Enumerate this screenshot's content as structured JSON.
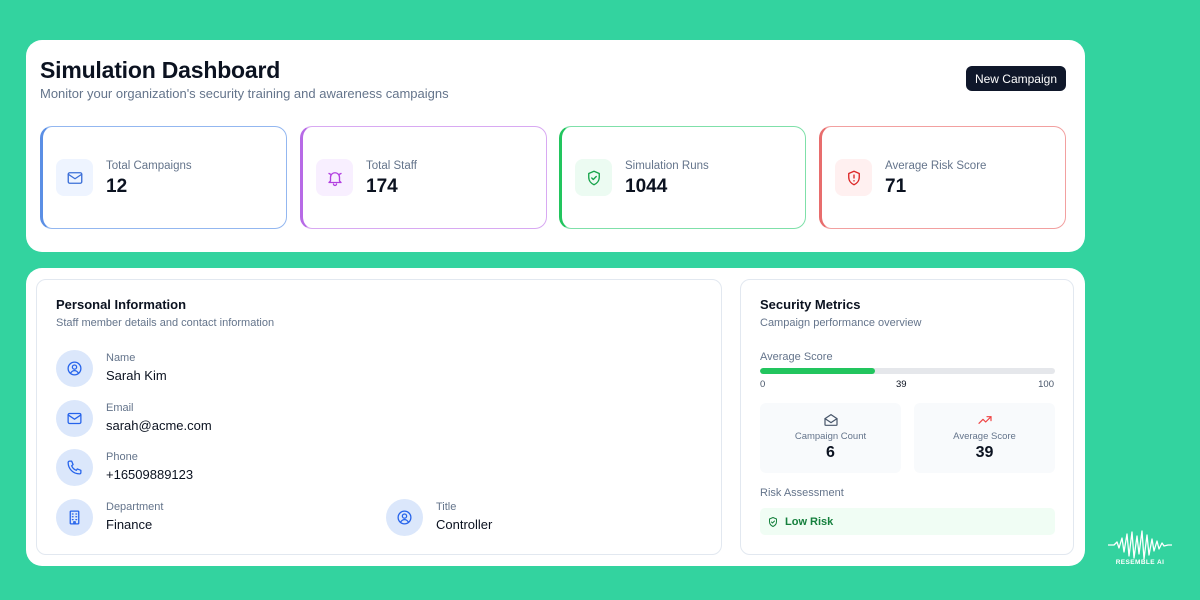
{
  "header": {
    "title": "Simulation Dashboard",
    "subtitle": "Monitor your organization's security training and awareness campaigns",
    "new_campaign_label": "New Campaign"
  },
  "stats": [
    {
      "label": "Total Campaigns",
      "value": "12",
      "icon": "mail-icon",
      "color": "#5b8fe5"
    },
    {
      "label": "Total Staff",
      "value": "174",
      "icon": "bell-icon",
      "color": "#b76ae6"
    },
    {
      "label": "Simulation Runs",
      "value": "1044",
      "icon": "shield-check-icon",
      "color": "#22c55e"
    },
    {
      "label": "Average Risk Score",
      "value": "71",
      "icon": "shield-alert-icon",
      "color": "#e86d6d"
    }
  ],
  "personal": {
    "title": "Personal Information",
    "subtitle": "Staff member details and contact information",
    "fields": {
      "name": {
        "label": "Name",
        "value": "Sarah Kim",
        "icon": "user-icon"
      },
      "email": {
        "label": "Email",
        "value": "sarah@acme.com",
        "icon": "mail-icon"
      },
      "phone": {
        "label": "Phone",
        "value": "+16509889123",
        "icon": "phone-icon"
      },
      "department": {
        "label": "Department",
        "value": "Finance",
        "icon": "building-icon"
      },
      "title": {
        "label": "Title",
        "value": "Controller",
        "icon": "user-icon"
      }
    }
  },
  "metrics": {
    "title": "Security Metrics",
    "subtitle": "Campaign performance overview",
    "average_score": {
      "label": "Average Score",
      "value": 39,
      "min": 0,
      "max": 100,
      "min_label": "0",
      "value_label": "39",
      "max_label": "100",
      "bar_color": "#22c55e"
    },
    "campaign_count": {
      "label": "Campaign Count",
      "value": "6",
      "icon": "mail-open-icon"
    },
    "average_score_card": {
      "label": "Average Score",
      "value": "39",
      "icon": "trending-up-icon"
    },
    "risk": {
      "label": "Risk Assessment",
      "value": "Low Risk",
      "icon": "shield-check-icon",
      "color": "#15803d"
    }
  },
  "brand": {
    "name": "RESEMBLE AI",
    "icon": "waveform-icon"
  }
}
